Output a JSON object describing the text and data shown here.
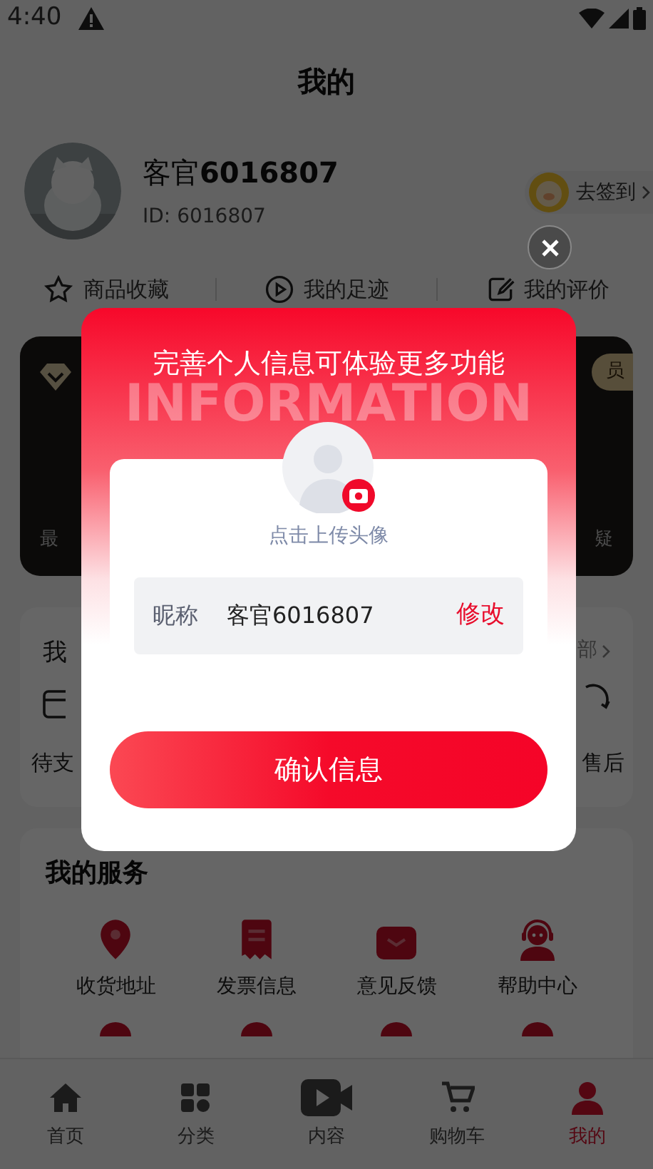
{
  "status_bar": {
    "time": "4:40"
  },
  "header": {
    "title": "我的"
  },
  "profile": {
    "name_prefix": "客官",
    "name_number": "6016807",
    "id": "ID: 6016807",
    "sign_in": "去签到"
  },
  "shortcuts": [
    {
      "label": "商品收藏",
      "kind": "star"
    },
    {
      "label": "我的足迹",
      "kind": "play"
    },
    {
      "label": "我的评价",
      "kind": "edit"
    }
  ],
  "vip_card": {
    "badge_fragment": "员",
    "left_fragment": "最",
    "right_fragment": "疑"
  },
  "orders": {
    "title_fragment": "我",
    "more_fragment": "部",
    "left_label_fragment": "待支",
    "right_label_fragment": "售后"
  },
  "services": {
    "title": "我的服务",
    "items": [
      {
        "label": "收货地址",
        "kind": "pin"
      },
      {
        "label": "发票信息",
        "kind": "receipt"
      },
      {
        "label": "意见反馈",
        "kind": "mail"
      },
      {
        "label": "帮助中心",
        "kind": "agent"
      }
    ]
  },
  "tabs": [
    {
      "label": "首页",
      "kind": "home",
      "selected": false
    },
    {
      "label": "分类",
      "kind": "grid",
      "selected": false
    },
    {
      "label": "内容",
      "kind": "video",
      "selected": false
    },
    {
      "label": "购物车",
      "kind": "cart",
      "selected": false
    },
    {
      "label": "我的",
      "kind": "person",
      "selected": true
    }
  ],
  "modal": {
    "title": "完善个人信息可体验更多功能",
    "watermark": "INFORMATION",
    "upload_hint": "点击上传头像",
    "field_label": "昵称",
    "field_value": "客官6016807",
    "edit_link": "修改",
    "confirm": "确认信息"
  }
}
